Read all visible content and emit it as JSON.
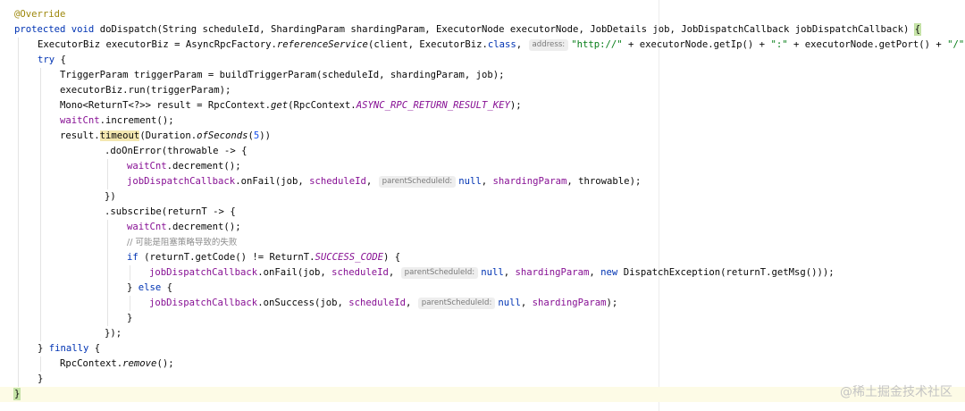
{
  "code": {
    "l1": {
      "annotation": "@Override"
    },
    "l2": {
      "kw1": "protected",
      "kw2": "void",
      "text": " doDispatch(String scheduleId, ShardingParam shardingParam, ExecutorNode executorNode, JobDetails job, JobDispatchCallback jobDispatchCallback) ",
      "brace": "{"
    },
    "l3": {
      "a": "ExecutorBiz executorBiz = AsyncRpcFactory.",
      "method": "referenceService",
      "b": "(client, ExecutorBiz.",
      "kw": "class",
      "c": ", ",
      "hint": "address:",
      "str1": "\"http://\"",
      "d": " + executorNode.getIp() + ",
      "str2": "\":\"",
      "e": " + executorNode.getPort() + ",
      "str3": "\"/\"",
      "f": ");"
    },
    "l4": {
      "kw": "try",
      "text": " {"
    },
    "l5": {
      "text": "TriggerParam triggerParam = buildTriggerParam(scheduleId, shardingParam, job);"
    },
    "l6": {
      "text": "executorBiz.run(triggerParam);"
    },
    "l7": {
      "a": "Mono<ReturnT<?>> result = RpcContext.",
      "method": "get",
      "b": "(RpcContext.",
      "constant": "ASYNC_RPC_RETURN_RESULT_KEY",
      "c": ");"
    },
    "l8": {
      "field": "waitCnt",
      "text": ".increment();"
    },
    "l9": {
      "a": "result.",
      "timeout": "timeout",
      "b": "(Duration.",
      "method": "ofSeconds",
      "c": "(",
      "num": "5",
      "d": "))"
    },
    "l10": {
      "text": ".doOnError(throwable -> {"
    },
    "l11": {
      "field": "waitCnt",
      "text": ".decrement();"
    },
    "l12": {
      "field1": "jobDispatchCallback",
      "a": ".onFail(job, ",
      "field2": "scheduleId",
      "b": ", ",
      "hint": "parentScheduleId:",
      "kw": "null",
      "c": ", ",
      "field3": "shardingParam",
      "d": ", throwable);"
    },
    "l13": {
      "text": "})"
    },
    "l14": {
      "text": ".subscribe(returnT -> {"
    },
    "l15": {
      "field": "waitCnt",
      "text": ".decrement();"
    },
    "l16": {
      "comment": "// 可能是阻塞策略导致的失败"
    },
    "l17": {
      "kw": "if",
      "a": " (returnT.getCode() != ReturnT.",
      "constant": "SUCCESS_CODE",
      "b": ") {"
    },
    "l18": {
      "field1": "jobDispatchCallback",
      "a": ".onFail(job, ",
      "field2": "scheduleId",
      "b": ", ",
      "hint": "parentScheduleId:",
      "kw1": "null",
      "c": ", ",
      "field3": "shardingParam",
      "d": ", ",
      "kw2": "new",
      "e": " DispatchException(returnT.getMsg()));"
    },
    "l19": {
      "a": "} ",
      "kw": "else",
      "b": " {"
    },
    "l20": {
      "field1": "jobDispatchCallback",
      "a": ".onSuccess(job, ",
      "field2": "scheduleId",
      "b": ", ",
      "hint": "parentScheduleId:",
      "kw": "null",
      "c": ", ",
      "field3": "shardingParam",
      "d": ");"
    },
    "l21": {
      "text": "}"
    },
    "l22": {
      "text": "});"
    },
    "l23": {
      "a": "} ",
      "kw": "finally",
      "b": " {"
    },
    "l24": {
      "a": "RpcContext.",
      "method": "remove",
      "b": "();"
    },
    "l25": {
      "text": "}"
    },
    "l26": {
      "brace": "}"
    }
  },
  "watermark": "@稀土掘金技术社区"
}
